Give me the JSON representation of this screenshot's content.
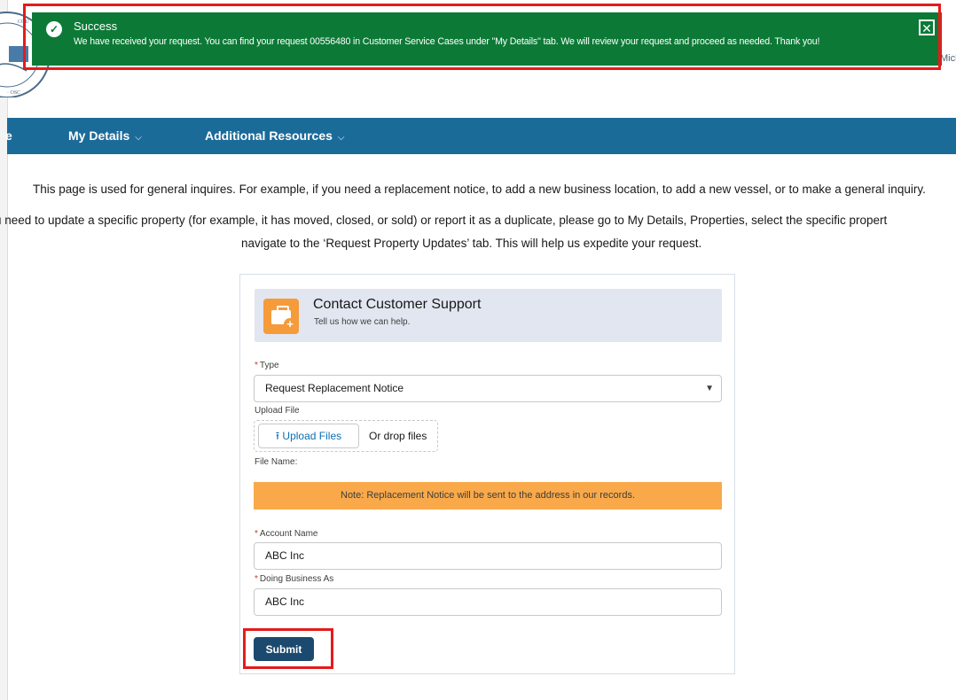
{
  "toast": {
    "title": "Success",
    "message": "We have received your request. You can find your request 00556480 in Customer Service Cases under \"My Details\" tab. We will review your request and proceed as needed. Thank you!"
  },
  "header": {
    "user_name": "Micke"
  },
  "nav": {
    "items": [
      {
        "label": "e"
      },
      {
        "label": "My Details"
      },
      {
        "label": "Additional Resources"
      }
    ]
  },
  "intro": {
    "line1": "This page is used for general inquires. For example, if you need a replacement notice, to add a new business location, to add a new vessel, or to make a general inquiry.",
    "line2": "u need to update a specific property (for example, it has moved, closed, or sold) or report it as a duplicate, please go to My Details, Properties, select the specific propert",
    "line3": "navigate to the ‘Request Property Updates’ tab. This will help us expedite your request."
  },
  "form": {
    "title": "Contact Customer Support",
    "subtitle": "Tell us how we can help.",
    "type_label": "Type",
    "type_value": "Request Replacement Notice",
    "upload_label": "Upload File",
    "upload_button": "Upload Files",
    "drop_text": "Or drop files",
    "file_name_label": "File Name:",
    "note": "Note: Replacement Notice will be sent to the address in our records.",
    "account_label": "Account Name",
    "account_value": "ABC Inc",
    "dba_label": "Doing Business As",
    "dba_value": "ABC Inc",
    "submit": "Submit"
  },
  "colors": {
    "toast": "#0c7a36",
    "nav": "#1b6b99",
    "note": "#f9a94a",
    "submit": "#1c4a6e",
    "highlight": "#e51b1b"
  }
}
